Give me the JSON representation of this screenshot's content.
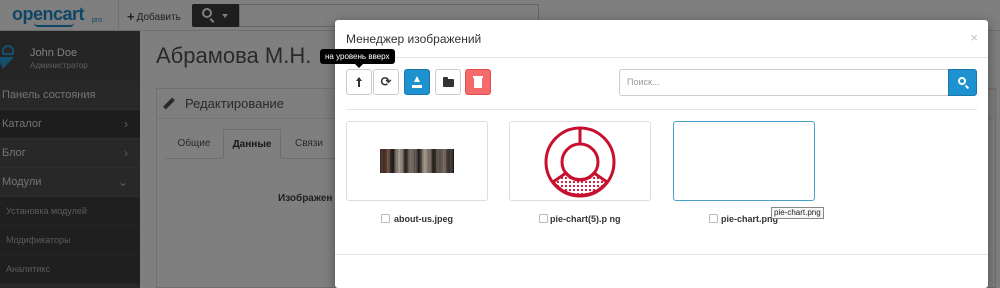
{
  "header": {
    "logo_text": "opencart",
    "logo_sub": "pro",
    "add_label": "Добавить",
    "add_icon": "plus-icon",
    "search_icon": "search-icon"
  },
  "sidebar": {
    "user_name": "John Doe",
    "user_role": "Администратор",
    "items": [
      {
        "label": "Панель состояния"
      },
      {
        "label": "Каталог",
        "chevron": "›"
      },
      {
        "label": "Блог",
        "chevron": "›"
      },
      {
        "label": "Модули",
        "chevron": "⌄"
      }
    ],
    "subitems": [
      {
        "label": "Установка модулей"
      },
      {
        "label": "Модификаторы"
      },
      {
        "label": "Аналитикс"
      }
    ]
  },
  "main": {
    "page_title": "Абрамова М.Н.",
    "panel_title": "Редактирование",
    "tabs": [
      {
        "label": "Общие"
      },
      {
        "label": "Данные"
      },
      {
        "label": "Связи"
      }
    ],
    "field_label": "Изображен"
  },
  "modal": {
    "title": "Менеджер изображений",
    "close": "×",
    "tooltip": "на уровень вверх",
    "search_placeholder": "Поиск...",
    "refresh_glyph": "⟳",
    "files": [
      {
        "name": "about-us.jpeg"
      },
      {
        "name": "pie-chart(5).p ng"
      },
      {
        "name": "pie-chart.png"
      }
    ],
    "hover_tip": "pie-chart.png"
  },
  "colors": {
    "primary": "#1e91cf",
    "danger": "#f56b6b",
    "sidebar": "#515151",
    "pie_red": "#c8102e"
  }
}
